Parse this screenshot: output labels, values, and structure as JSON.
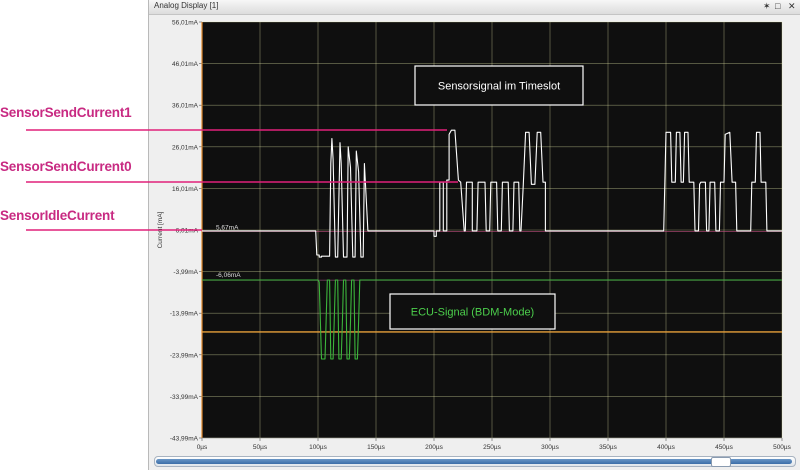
{
  "window": {
    "title": "Analog Display [1]",
    "pin_icon": "pin-icon",
    "restore_icon": "restore-icon",
    "close_icon": "close-icon",
    "pin_glyph": "✶",
    "restore_glyph": "□",
    "close_glyph": "✕"
  },
  "labels": {
    "sensor_send_1": "SensorSendCurrent1",
    "sensor_send_0": "SensorSendCurrent0",
    "sensor_idle": "SensorIdleCurrent"
  },
  "annotations": {
    "sensor_box": "Sensorsignal im Timeslot",
    "ecu_box": "ECU-Signal (BDM-Mode)",
    "marker_sensor": "5,67mA",
    "marker_ecu": "-6,06mA"
  },
  "colors": {
    "label_magenta": "#c82a82",
    "plot_bg": "#0f0f0f",
    "grid": "#e2e5a5",
    "sensor_trace": "#ffffff",
    "ecu_trace": "#3cb53c",
    "orange_line": "#e8a03a",
    "pointer_line": "#e0207a"
  },
  "scrollbar": {
    "position": 0.9
  },
  "chart_data": {
    "type": "line",
    "ylabel": "Current [mA]",
    "xlim": [
      0,
      500
    ],
    "ylim": [
      -43.99,
      56.01
    ],
    "grid": true,
    "x_ticks": [
      "0µs",
      "50µs",
      "100µs",
      "150µs",
      "200µs",
      "250µs",
      "300µs",
      "350µs",
      "400µs",
      "450µs",
      "500µs"
    ],
    "y_ticks": [
      {
        "v": 56.01,
        "label": "56,01mA"
      },
      {
        "v": 46.01,
        "label": "46,01mA"
      },
      {
        "v": 36.01,
        "label": "36,01mA"
      },
      {
        "v": 26.01,
        "label": "26,01mA"
      },
      {
        "v": 16.01,
        "label": "16,01mA"
      },
      {
        "v": 6.01,
        "label": "6,01mA"
      },
      {
        "v": -3.99,
        "label": "-3,99mA"
      },
      {
        "v": -13.99,
        "label": "-13,99mA"
      },
      {
        "v": -23.99,
        "label": "-23,99mA"
      },
      {
        "v": -33.99,
        "label": "-33,99mA"
      },
      {
        "v": -43.99,
        "label": "-43,99mA"
      }
    ],
    "reference_lines": [
      {
        "name": "orange",
        "y": -18.5
      },
      {
        "name": "sensor-marker",
        "y": 5.67
      },
      {
        "name": "ecu-marker",
        "y": -6.06
      }
    ],
    "series": [
      {
        "key": "sensor",
        "points": [
          [
            0,
            5.8
          ],
          [
            98,
            5.8
          ],
          [
            99,
            0
          ],
          [
            101,
            0
          ],
          [
            101,
            -0.5
          ],
          [
            103,
            -0.5
          ],
          [
            103,
            -0.3
          ],
          [
            110,
            -0.3
          ],
          [
            111,
            22
          ],
          [
            112,
            28
          ],
          [
            113,
            23
          ],
          [
            115,
            -0.5
          ],
          [
            117,
            -0.5
          ],
          [
            119,
            27
          ],
          [
            120,
            22
          ],
          [
            122,
            -0.5
          ],
          [
            125,
            -0.5
          ],
          [
            126,
            26
          ],
          [
            128,
            21
          ],
          [
            130,
            -0.5
          ],
          [
            132,
            -0.5
          ],
          [
            133,
            25
          ],
          [
            135,
            20
          ],
          [
            137,
            -0.5
          ],
          [
            139,
            -0.5
          ],
          [
            140,
            22
          ],
          [
            143,
            5.8
          ],
          [
            145,
            5.8
          ],
          [
            200,
            5.8
          ],
          [
            200,
            4.5
          ],
          [
            202,
            4.5
          ],
          [
            202,
            5.8
          ],
          [
            205,
            5.8
          ],
          [
            205,
            17.5
          ],
          [
            208,
            17.5
          ],
          [
            208,
            5.8
          ],
          [
            211,
            5.8
          ],
          [
            211,
            18
          ],
          [
            213,
            18
          ],
          [
            213,
            29
          ],
          [
            215,
            30
          ],
          [
            218,
            30
          ],
          [
            221,
            18
          ],
          [
            223,
            17.5
          ],
          [
            226,
            5.8
          ],
          [
            227,
            5.8
          ],
          [
            228,
            17.5
          ],
          [
            233,
            17.5
          ],
          [
            233,
            5.8
          ],
          [
            237,
            5.8
          ],
          [
            238,
            17.5
          ],
          [
            244,
            17.5
          ],
          [
            245,
            5.8
          ],
          [
            248,
            5.8
          ],
          [
            249,
            17.5
          ],
          [
            254,
            17.5
          ],
          [
            255,
            5.8
          ],
          [
            258,
            5.8
          ],
          [
            259,
            17.5
          ],
          [
            264,
            17.5
          ],
          [
            265,
            5.8
          ],
          [
            268,
            5.8
          ],
          [
            269,
            17.5
          ],
          [
            273,
            17.5
          ],
          [
            274,
            5.8
          ],
          [
            275,
            5.8
          ],
          [
            277,
            17
          ],
          [
            279,
            29.5
          ],
          [
            282,
            29.5
          ],
          [
            284,
            17
          ],
          [
            287,
            17
          ],
          [
            289,
            29.5
          ],
          [
            292,
            29.5
          ],
          [
            294,
            17.5
          ],
          [
            296,
            17.5
          ],
          [
            296,
            5.8
          ],
          [
            398,
            5.8
          ],
          [
            399,
            17
          ],
          [
            400,
            29.5
          ],
          [
            404,
            29.5
          ],
          [
            405,
            17.5
          ],
          [
            408,
            17.5
          ],
          [
            409,
            29.5
          ],
          [
            412,
            29.5
          ],
          [
            413,
            17.5
          ],
          [
            415,
            17.5
          ],
          [
            416,
            29.5
          ],
          [
            419,
            29.5
          ],
          [
            420,
            17.5
          ],
          [
            424,
            17.5
          ],
          [
            425,
            5.8
          ],
          [
            428,
            5.8
          ],
          [
            429,
            17
          ],
          [
            430,
            17.5
          ],
          [
            434,
            17.5
          ],
          [
            435,
            5.8
          ],
          [
            437,
            5.8
          ],
          [
            438,
            17.5
          ],
          [
            442,
            17.5
          ],
          [
            443,
            5.8
          ],
          [
            446,
            5.8
          ],
          [
            447,
            17.5
          ],
          [
            450,
            17.5
          ],
          [
            451,
            29
          ],
          [
            455,
            29.5
          ],
          [
            457,
            17.5
          ],
          [
            460,
            17.5
          ],
          [
            461,
            5.8
          ],
          [
            473,
            5.8
          ],
          [
            474,
            17.5
          ],
          [
            477,
            17.5
          ],
          [
            478,
            29.5
          ],
          [
            481,
            29.5
          ],
          [
            482,
            17.5
          ],
          [
            486,
            17.5
          ],
          [
            487,
            5.8
          ],
          [
            500,
            5.8
          ]
        ]
      },
      {
        "key": "ecu",
        "points": [
          [
            0,
            -6.0
          ],
          [
            100,
            -6.0
          ],
          [
            101,
            -6.5
          ],
          [
            103,
            -25
          ],
          [
            106,
            -25
          ],
          [
            107,
            -16
          ],
          [
            108,
            -6
          ],
          [
            110,
            -6
          ],
          [
            111,
            -25
          ],
          [
            113,
            -25
          ],
          [
            114,
            -16
          ],
          [
            115,
            -6
          ],
          [
            117,
            -6
          ],
          [
            118,
            -25
          ],
          [
            120,
            -25
          ],
          [
            121,
            -16
          ],
          [
            122,
            -6
          ],
          [
            124,
            -6
          ],
          [
            125,
            -25
          ],
          [
            127,
            -25
          ],
          [
            128,
            -16
          ],
          [
            129,
            -6
          ],
          [
            131,
            -6
          ],
          [
            132,
            -25
          ],
          [
            134,
            -25
          ],
          [
            135,
            -16
          ],
          [
            136,
            -6
          ],
          [
            140,
            -6.0
          ],
          [
            500,
            -6.0
          ]
        ]
      }
    ]
  }
}
